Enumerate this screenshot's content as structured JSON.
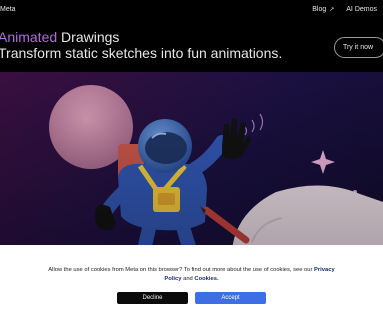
{
  "header": {
    "brand": "Meta",
    "nav": [
      {
        "label": "Blog",
        "icon": "external-link-icon",
        "ext": "↗"
      },
      {
        "label": "AI Demos"
      }
    ]
  },
  "hero": {
    "title_accent": "Animated",
    "title_rest": "Drawings",
    "subtitle": "Transform static sketches into fun animations.",
    "cta_label": "Try it now"
  },
  "cookie_banner": {
    "text_before": "Allow the use of cookies from Meta on this browser? To find out more about the use of cookies, see our",
    "privacy_link": "Privacy Policy",
    "and": "and",
    "cookies_link": "Cookies.",
    "decline_label": "Decline",
    "accept_label": "Accept"
  },
  "colors": {
    "accent": "#b06fd8",
    "accept_button": "#3d6ee6",
    "decline_button": "#0b0b0b"
  }
}
